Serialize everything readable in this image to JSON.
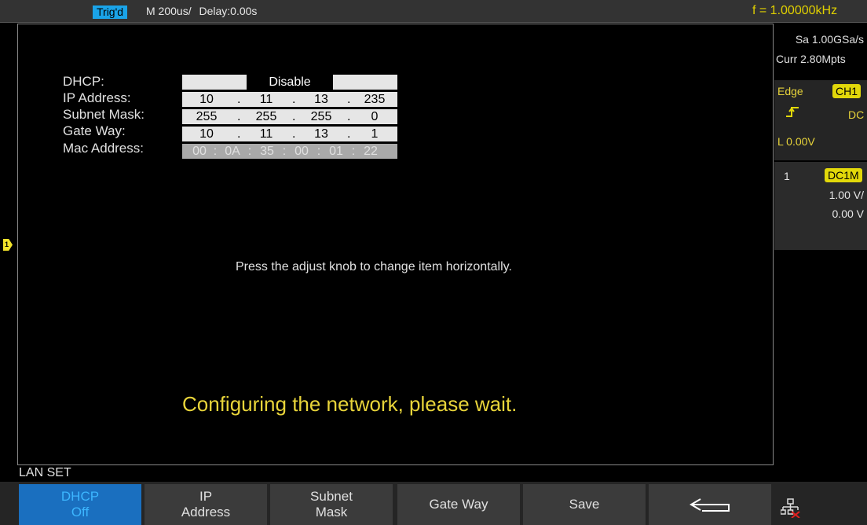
{
  "status": {
    "trigger": "Trig'd",
    "timebase": "M 200us/",
    "delay": "Delay:0.00s",
    "frequency": "f = 1.00000kHz"
  },
  "sidebar": {
    "sample_rate": "Sa 1.00GSa/s",
    "memory_depth": "Curr 2.80Mpts",
    "trigger_type": "Edge",
    "trigger_source": "CH1",
    "trigger_coupling": "DC",
    "trigger_level": "L   0.00V",
    "channel_number": "1",
    "channel_coupling": "DC1M",
    "channel_scale": "1.00 V/",
    "channel_offset": "0.00 V"
  },
  "lan": {
    "dhcp_label": "DHCP:",
    "dhcp_value": "Disable",
    "ip_label": "IP Address:",
    "ip": [
      "10",
      "11",
      "13",
      "235"
    ],
    "subnet_label": "Subnet Mask:",
    "subnet": [
      "255",
      "255",
      "255",
      "0"
    ],
    "gateway_label": "Gate Way:",
    "gateway": [
      "10",
      "11",
      "13",
      "1"
    ],
    "mac_label": "Mac Address:",
    "mac": [
      "00",
      "0A",
      "35",
      "00",
      "01",
      "22"
    ],
    "hint": "Press the adjust knob to change item horizontally.",
    "message": "Configuring the network, please wait."
  },
  "menu": {
    "title": "LAN SET",
    "dhcp_line1": "DHCP",
    "dhcp_line2": "Off",
    "ip_line1": "IP",
    "ip_line2": "Address",
    "subnet_line1": "Subnet",
    "subnet_line2": "Mask",
    "gateway": "Gate Way",
    "save": "Save"
  },
  "colors": {
    "accent": "#1aa3e8",
    "trigger_yellow": "#e2d80a",
    "message_yellow": "#e8d43a"
  },
  "icons": {
    "back": "return-arrow-icon",
    "lan": "network-icon",
    "channel_marker": "ch1-level-marker"
  }
}
